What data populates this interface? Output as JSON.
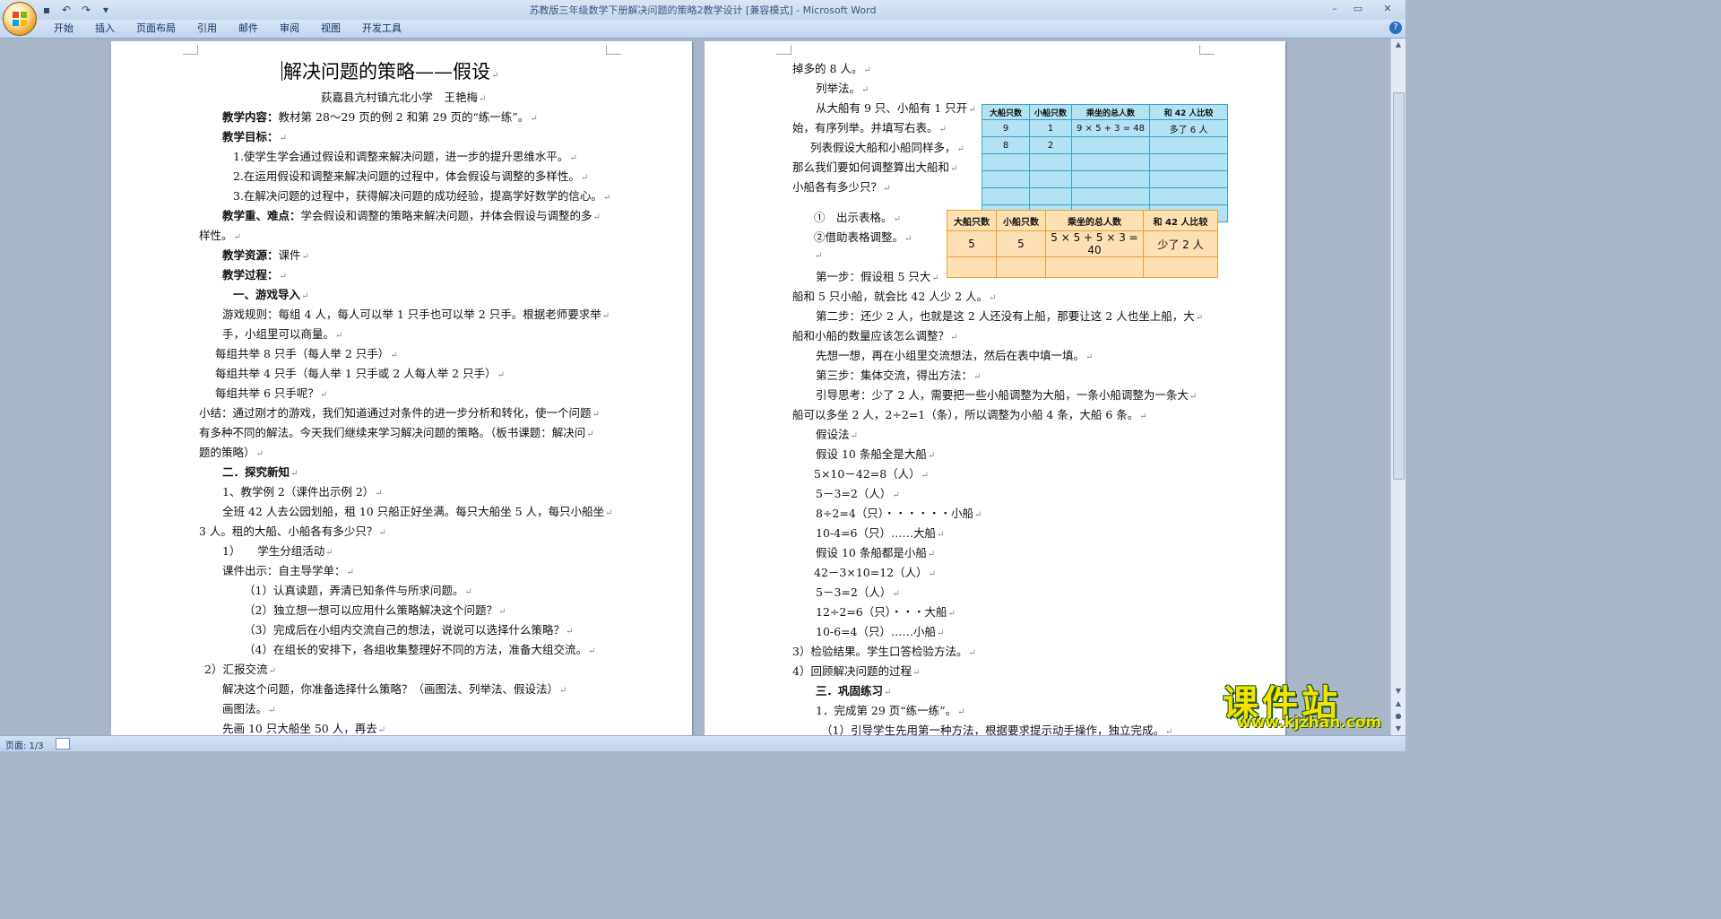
{
  "window": {
    "title": "苏教版三年级数学下册解决问题的策略2教学设计 [兼容模式] - Microsoft Word",
    "tabs": [
      "开始",
      "插入",
      "页面布局",
      "引用",
      "邮件",
      "审阅",
      "视图",
      "开发工具"
    ]
  },
  "status": {
    "page": "页面: 1/3"
  },
  "left_page": {
    "title": "解决问题的策略——假设",
    "author": "荻嘉县亢村镇亢北小学　王艳梅",
    "lines": [
      {
        "b": "教学内容：",
        "t": "教材第 28～29 页的例 2 和第 29 页的“练一练”。"
      },
      {
        "b": "教学目标：",
        "t": ""
      },
      {
        "b": "",
        "t": "1.使学生学会通过假设和调整来解决问题，进一步的提升思维水平。"
      },
      {
        "b": "",
        "t": "2.在运用假设和调整来解决问题的过程中，体会假设与调整的多样性。"
      },
      {
        "b": "",
        "t": "3.在解决问题的过程中，获得解决问题的成功经验，提高学好数学的信心。"
      },
      {
        "b": "教学重、难点：",
        "t": "学会假设和调整的策略来解决问题，并体会假设与调整的多"
      },
      {
        "b": "",
        "t": "样性。"
      },
      {
        "b": "教学资源：",
        "t": "课件"
      },
      {
        "b": "教学过程：",
        "t": ""
      },
      {
        "b": "一、游戏导入",
        "t": ""
      },
      {
        "b": "",
        "t": "游戏规则：每组 4 人，每人可以举 1 只手也可以举 2 只手。根据老师要求举"
      },
      {
        "b": "",
        "t": "手，小组里可以商量。"
      },
      {
        "b": "",
        "t": "每组共举 8 只手（每人举 2 只手）"
      },
      {
        "b": "",
        "t": "每组共举 4 只手（每人举 1 只手或 2 人每人举 2 只手）"
      },
      {
        "b": "",
        "t": "每组共举 6 只手呢？"
      },
      {
        "b": "",
        "t": "小结：通过刚才的游戏，我们知道通过对条件的进一步分析和转化，使一个问题"
      },
      {
        "b": "",
        "t": "有多种不同的解法。今天我们继续来学习解决问题的策略。（板书课题：解决问"
      },
      {
        "b": "",
        "t": "题的策略）"
      },
      {
        "b": "二．探究新知",
        "t": ""
      },
      {
        "b": "",
        "t": "1、教学例 2（课件出示例 2）"
      },
      {
        "b": "",
        "t": "全班 42 人去公园划船，租 10 只船正好坐满。每只大船坐 5 人，每只小船坐"
      },
      {
        "b": "",
        "t": "3 人。租的大船、小船各有多少只？"
      },
      {
        "b": "",
        "t": "1）　　学生分组活动"
      },
      {
        "b": "",
        "t": "课件出示：自主导学单："
      },
      {
        "b": "",
        "t": "（1）认真读题，弄清已知条件与所求问题。"
      },
      {
        "b": "",
        "t": "（2）独立想一想可以应用什么策略解决这个问题？"
      },
      {
        "b": "",
        "t": "（3）完成后在小组内交流自己的想法，说说可以选择什么策略？"
      },
      {
        "b": "",
        "t": "（4）在组长的安排下，各组收集整理好不同的方法，准备大组交流。"
      },
      {
        "b": "",
        "t": "2）汇报交流"
      },
      {
        "b": "",
        "t": "解决这个问题，你准备选择什么策略？（画图法、列举法、假设法）"
      },
      {
        "b": "",
        "t": "画图法。"
      },
      {
        "b": "",
        "t": "先画 10 只大船坐 50 人，再去"
      }
    ]
  },
  "right_page": {
    "lines": [
      {
        "b": "",
        "t": "掉多的 8 人。"
      },
      {
        "b": "",
        "t": "列举法。"
      },
      {
        "b": "",
        "t": "从大船有 9 只、小船有 1 只开"
      },
      {
        "b": "",
        "t": "始，有序列举。并填写右表。"
      },
      {
        "b": "",
        "t": "列表假设大船和小船同样多，"
      },
      {
        "b": "",
        "t": "那么我们要如何调整算出大船和"
      },
      {
        "b": "",
        "t": "小船各有多少只？"
      },
      {
        "b": "",
        "t": "①　出示表格。"
      },
      {
        "b": "",
        "t": "②借助表格调整。"
      },
      {
        "b": "",
        "t": ""
      },
      {
        "b": "",
        "t": "第一步：假设租 5 只大"
      },
      {
        "b": "",
        "t": "船和 5 只小船，就会比 42 人少 2 人。"
      },
      {
        "b": "",
        "t": "第二步：还少 2 人，也就是这 2 人还没有上船，那要让这 2 人也坐上船，大"
      },
      {
        "b": "",
        "t": "船和小船的数量应该怎么调整？"
      },
      {
        "b": "",
        "t": "先想一想，再在小组里交流想法，然后在表中填一填。"
      },
      {
        "b": "",
        "t": "第三步：集体交流，得出方法："
      },
      {
        "b": "",
        "t": "引导思考：少了 2 人，需要把一些小船调整为大船，一条小船调整为一条大"
      },
      {
        "b": "",
        "t": "船可以多坐 2 人，2÷2=1（条），所以调整为小船 4 条，大船 6 条。"
      },
      {
        "b": "",
        "t": "假设法"
      },
      {
        "b": "",
        "t": "假设 10 条船全是大船"
      },
      {
        "b": "",
        "t": "5×10－42=8（人）"
      },
      {
        "b": "",
        "t": "5－3=2（人）"
      },
      {
        "b": "",
        "t": "8÷2=4（只）・・・・・・小船"
      },
      {
        "b": "",
        "t": "10-4=6（只）……大船"
      },
      {
        "b": "",
        "t": "假设 10 条船都是小船"
      },
      {
        "b": "",
        "t": "42－3×10=12（人）"
      },
      {
        "b": "",
        "t": "5－3=2（人）"
      },
      {
        "b": "",
        "t": "12÷2=6（只）・・・大船"
      },
      {
        "b": "",
        "t": "10-6=4（只）……小船"
      },
      {
        "b": "",
        "t": "3）检验结果。学生口答检验方法。"
      },
      {
        "b": "",
        "t": "4）回顾解决问题的过程"
      },
      {
        "b": "三．巩固练习",
        "t": ""
      },
      {
        "b": "",
        "t": "1．完成第 29 页“练一练”。"
      },
      {
        "b": "",
        "t": "（1）引导学生先用第一种方法，根据要求提示动手操作，独立完成。"
      }
    ],
    "table_blue": {
      "headers": [
        "大船只数",
        "小船只数",
        "乘坐的总人数",
        "和 42 人比较"
      ],
      "rows": [
        [
          "9",
          "1",
          "9 × 5 + 3 = 48",
          "多了 6 人"
        ],
        [
          "8",
          "2",
          "",
          ""
        ],
        [
          "",
          "",
          "",
          ""
        ],
        [
          "",
          "",
          "",
          ""
        ],
        [
          "",
          "",
          "",
          ""
        ],
        [
          "",
          "",
          "",
          ""
        ]
      ]
    },
    "table_orange": {
      "headers": [
        "大船只数",
        "小船只数",
        "乘坐的总人数",
        "和 42 人比较"
      ],
      "rows": [
        [
          "5",
          "5",
          "5 × 5 + 5 × 3 = 40",
          "少了 2 人"
        ],
        [
          "",
          "",
          "",
          ""
        ]
      ]
    }
  },
  "watermark": {
    "big": "课件站",
    "small": "www.kjzhan.com"
  }
}
